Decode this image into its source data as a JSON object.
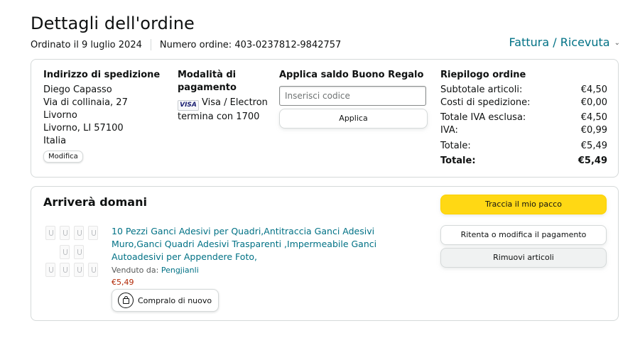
{
  "header": {
    "title": "Dettagli dell'ordine",
    "ordered_on": "Ordinato il 9 luglio 2024",
    "order_number": "Numero ordine: 403-0237812-9842757",
    "invoice_link": "Fattura / Ricevuta"
  },
  "shipping": {
    "title": "Indirizzo di spedizione",
    "lines": [
      "Diego Capasso",
      "Via di collinaia, 27",
      "Livorno",
      "Livorno, LI 57100",
      "Italia"
    ],
    "edit_label": "Modifica"
  },
  "payment": {
    "title": "Modalità di pagamento",
    "card_logo": "VISA",
    "card_name": "Visa / Electron",
    "card_ending": "termina con 1700"
  },
  "gift_card": {
    "title": "Applica saldo Buono Regalo",
    "placeholder": "Inserisci codice",
    "apply_label": "Applica"
  },
  "summary": {
    "title": "Riepilogo ordine",
    "rows": [
      {
        "label": "Subtotale articoli:",
        "value": "€4,50"
      },
      {
        "label": "Costi di spedizione:",
        "value": "€0,00"
      },
      {
        "label": "Totale IVA esclusa:",
        "value": "€4,50"
      },
      {
        "label": "IVA:",
        "value": "€0,99"
      },
      {
        "label": "Totale:",
        "value": "€5,49"
      },
      {
        "label": "Totale:",
        "value": "€5,49"
      }
    ]
  },
  "shipment": {
    "status": "Arriverà domani",
    "product_title": "10 Pezzi Ganci Adesivi per Quadri,Antitraccia Ganci Adesivi Muro,Ganci Quadri Adesivi Trasparenti ,Impermeabile Ganci Autoadesivi per Appendere Foto,",
    "sold_by_label": "Venduto da:",
    "seller": "Pengjianli",
    "price": "€5,49",
    "buy_again_label": "Compralo di nuovo",
    "track_label": "Traccia il mio pacco",
    "retry_label": "Ritenta o modifica il pagamento",
    "remove_label": "Rimuovi articoli"
  },
  "colors": {
    "link": "#007185",
    "price": "#b12704",
    "primary_button": "#ffd814",
    "border": "#d5d9d9"
  }
}
